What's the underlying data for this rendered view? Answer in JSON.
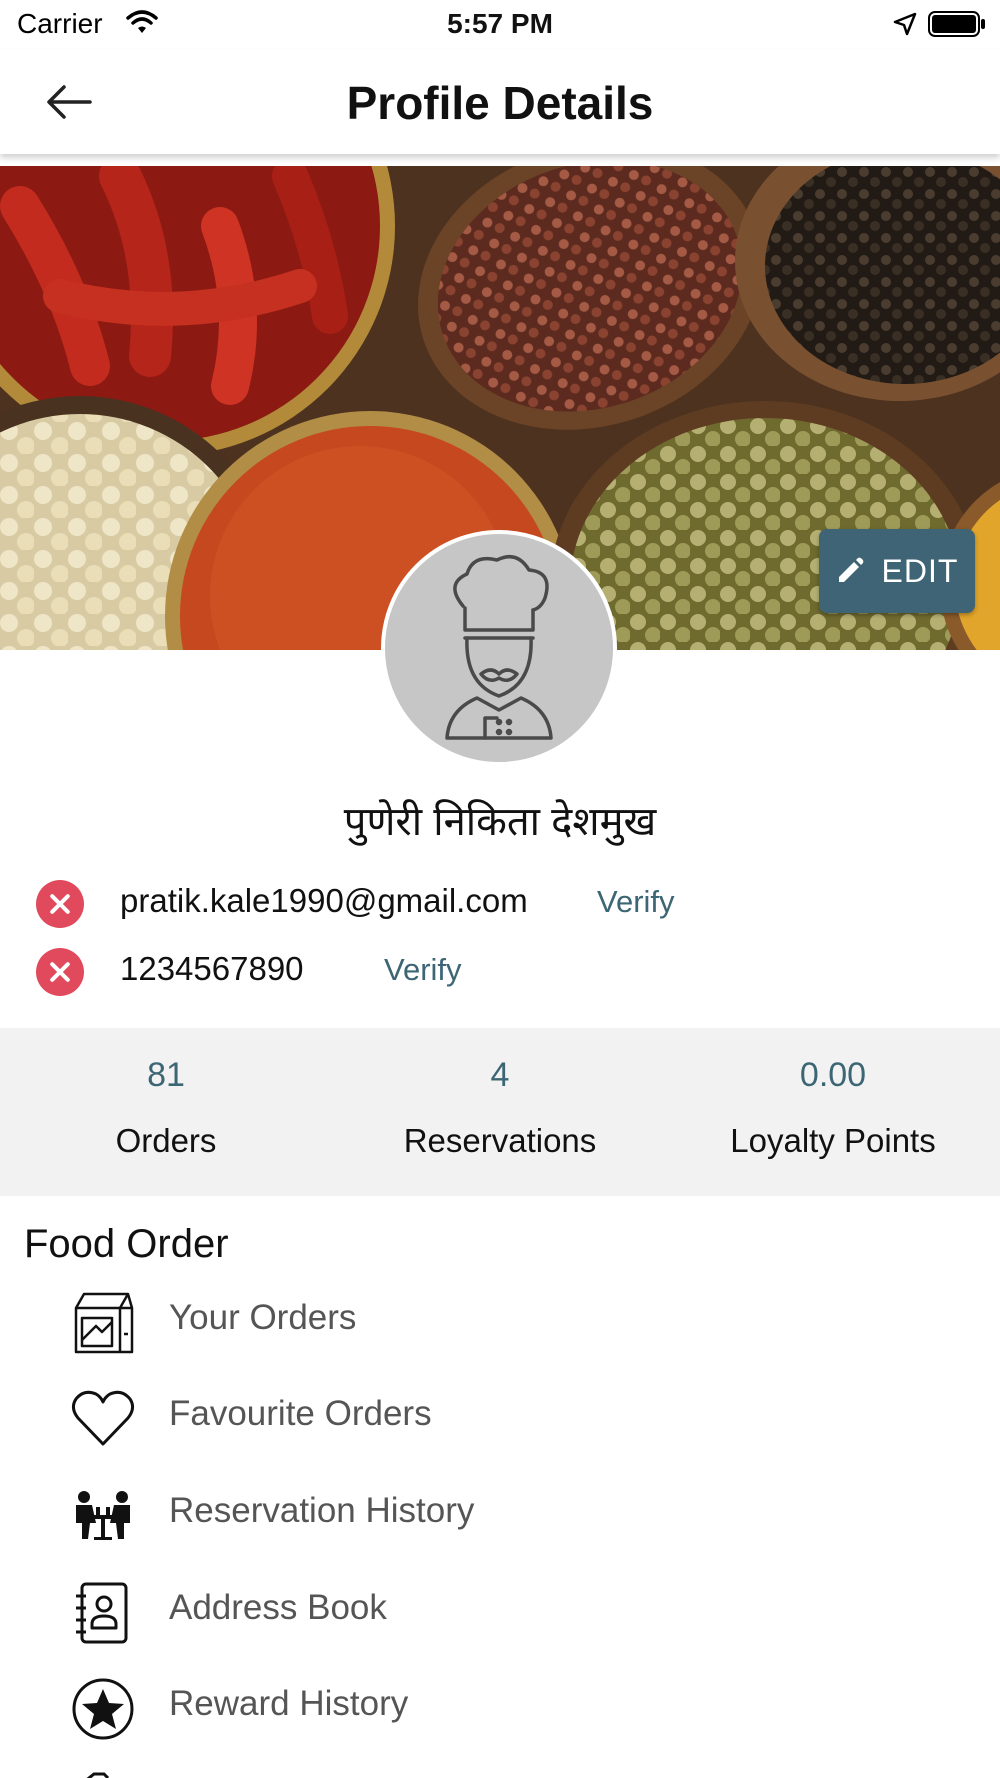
{
  "status_bar": {
    "carrier": "Carrier",
    "time": "5:57 PM"
  },
  "header": {
    "title": "Profile Details"
  },
  "profile": {
    "edit_label": "EDIT",
    "name": "पुणेरी निकिता देशमुख",
    "email": "pratik.kale1990@gmail.com",
    "email_verify": "Verify",
    "phone": "1234567890",
    "phone_verify": "Verify"
  },
  "stats": [
    {
      "value": "81",
      "label": "Orders"
    },
    {
      "value": "4",
      "label": "Reservations"
    },
    {
      "value": "0.00",
      "label": "Loyalty Points"
    }
  ],
  "food_order": {
    "title": "Food Order",
    "items": [
      {
        "label": "Your Orders",
        "icon": "orders-bag-icon"
      },
      {
        "label": "Favourite Orders",
        "icon": "heart-icon"
      },
      {
        "label": "Reservation History",
        "icon": "dining-table-icon"
      },
      {
        "label": "Address Book",
        "icon": "address-book-icon"
      },
      {
        "label": "Reward History",
        "icon": "star-circle-icon"
      }
    ]
  },
  "colors": {
    "accent": "#3f6475",
    "error": "#e04a5c",
    "stats_bg": "#f2f2f2"
  }
}
